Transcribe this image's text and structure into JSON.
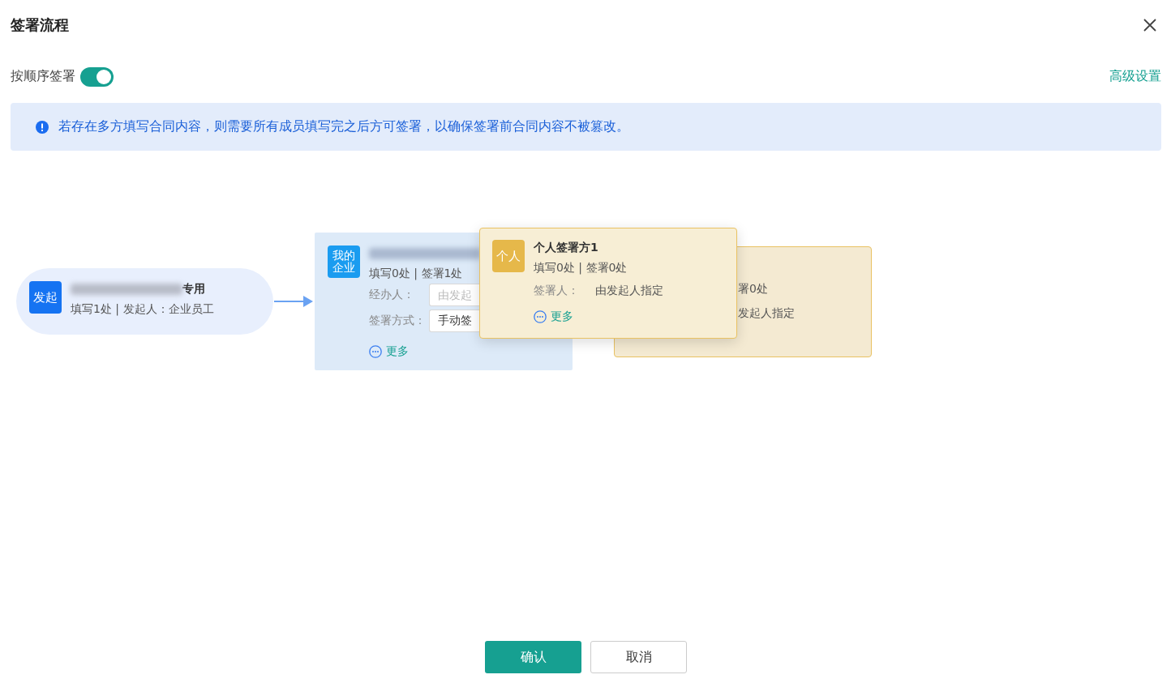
{
  "dialog": {
    "title": "签署流程"
  },
  "sequential_signing": {
    "label": "按顺序签署",
    "on": true
  },
  "advanced_settings": "高级设置",
  "notice": "若存在多方填写合同内容，则需要所有成员填写完之后方可签署，以确保签署前合同内容不被篡改。",
  "flow": {
    "nodes": [
      {
        "kind": "initiator",
        "dragging": false,
        "badge": "发起",
        "name_redacted": true,
        "name": "专用",
        "summary": "填写1处 | 发起人：企业员工"
      },
      {
        "kind": "enterprise",
        "dragging": false,
        "badge": "我的企业",
        "name_redacted": true,
        "summary": "填写0处 | 签署1处",
        "fields": [
          {
            "label": "经办人：",
            "placeholder": "由发起"
          },
          {
            "label": "签署方式：",
            "value": "手动签"
          }
        ],
        "more": "更多"
      },
      {
        "kind": "personal",
        "dragging": true,
        "badge": "个人",
        "name": "个人签署方1",
        "summary": "填写0处 | 签署0处",
        "signer_label": "签署人：",
        "signer": "由发起人指定",
        "more": "更多"
      },
      {
        "kind": "drop-target",
        "dragging": false,
        "summary": "署0处",
        "signer": "发起人指定"
      }
    ]
  },
  "buttons": [
    {
      "label": "确认",
      "kind": "primary"
    },
    {
      "label": "取消",
      "kind": "default"
    }
  ]
}
